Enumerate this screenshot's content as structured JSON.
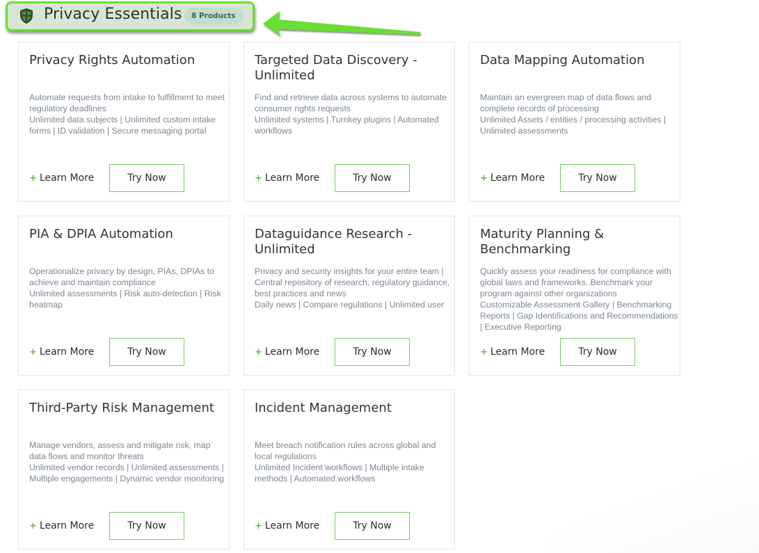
{
  "section": {
    "title": "Privacy Essentials",
    "badge": "8 Products",
    "icon": "shield-icon"
  },
  "colors": {
    "accent_green": "#6ade33",
    "header_bg": "#d9e5d4",
    "badge_bg": "#c3dccd",
    "badge_text": "#3e6b52",
    "button_border": "#7bc86a",
    "plus_green": "#63b844",
    "desc_text": "#7b8593"
  },
  "cards": [
    {
      "title": "Privacy Rights Automation",
      "desc": "Automate requests from intake to fulfillment to meet regulatory deadlines",
      "features": "Unlimited data subjects | Unlimited custom intake forms | ID validation | Secure messaging portal",
      "learn_more": "Learn More",
      "try_now": "Try Now"
    },
    {
      "title": "Targeted Data Discovery - Unlimited",
      "desc": "Find and retrieve data across systems to automate consumer rights requests",
      "features": "Unlimited systems | Turnkey plugins | Automated workflows",
      "learn_more": "Learn More",
      "try_now": "Try Now"
    },
    {
      "title": "Data Mapping Automation",
      "desc": "Maintain an evergreen map of data flows and complete records of processing",
      "features": "Unlimited Assets / entities / processing activities | Unlimited assessments",
      "learn_more": "Learn More",
      "try_now": "Try Now"
    },
    {
      "title": "PIA & DPIA Automation",
      "desc": "Operationalize privacy by design, PIAs, DPIAs to achieve and maintain compliance",
      "features": "Unlimited assessments | Risk auto-detection | Risk heatmap",
      "learn_more": "Learn More",
      "try_now": "Try Now"
    },
    {
      "title": "Dataguidance Research - Unlimited",
      "desc": "Privacy and security insights for your entire team | Central repository of research, regulatory guidance, best practices and news",
      "features": "Daily news | Compare regulations | Unlimited user",
      "learn_more": "Learn More",
      "try_now": "Try Now"
    },
    {
      "title": "Maturity Planning & Benchmarking",
      "desc": "Quickly assess your readiness for compliance with global laws and frameworks. Benchmark your program against other organizations",
      "features": "Customizable Assessment Gallery | Benchmarking Reports | Gap Identifications and Recommendations | Executive Reporting",
      "learn_more": "Learn More",
      "try_now": "Try Now"
    },
    {
      "title": "Third-Party Risk Management",
      "desc": "Manage vendors, assess and mitigate risk, map data flows and monitor threats",
      "features": "Unlimited vendor records | Unlimited assessments | Multiple engagements | Dynamic vendor monitoring",
      "learn_more": "Learn More",
      "try_now": "Try Now"
    },
    {
      "title": "Incident Management",
      "desc": "Meet breach notification rules across global and local regulations",
      "features": "Unlimited Incident workflows | Multiple intake methods | Automated workflows",
      "learn_more": "Learn More",
      "try_now": "Try Now"
    }
  ]
}
